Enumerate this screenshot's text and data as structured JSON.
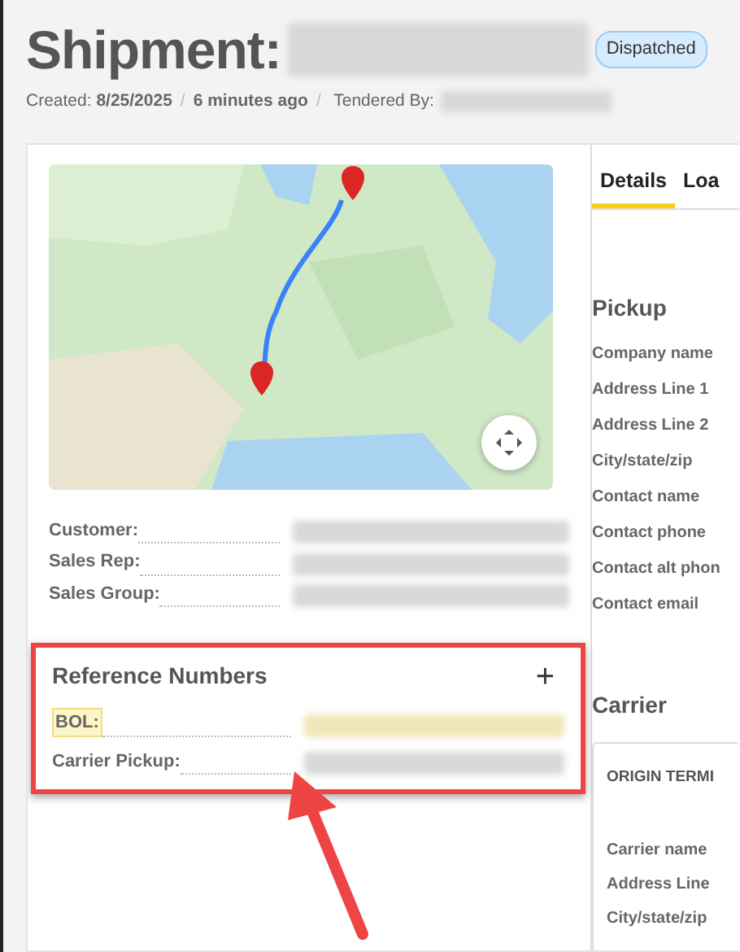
{
  "header": {
    "title": "Shipment:",
    "status_badge": "Dispatched",
    "created_label": "Created:",
    "created_date": "8/25/2025",
    "separator_1": "/",
    "age": "6 minutes ago",
    "separator_2": "/",
    "tendered_label": "Tendered By:"
  },
  "summary_fields": [
    {
      "label": "Customer:"
    },
    {
      "label": "Sales Rep:"
    },
    {
      "label": "Sales Group:"
    }
  ],
  "reference_numbers": {
    "title": "Reference Numbers",
    "add_icon": "+",
    "items": [
      {
        "label": "BOL:",
        "highlighted": true
      },
      {
        "label": "Carrier Pickup:",
        "highlighted": false
      }
    ]
  },
  "tabs": [
    {
      "label": "Details",
      "selected": true
    },
    {
      "label": "Loa",
      "selected": false
    }
  ],
  "pickup": {
    "title": "Pickup",
    "fields": [
      "Company name",
      "Address Line 1",
      "Address Line 2",
      "City/state/zip",
      "Contact name",
      "Contact phone",
      "Contact alt phon",
      "Contact email"
    ]
  },
  "carrier": {
    "title": "Carrier",
    "card_title": "ORIGIN TERMI",
    "fields": [
      "Carrier name",
      "Address Line",
      "City/state/zip"
    ]
  }
}
